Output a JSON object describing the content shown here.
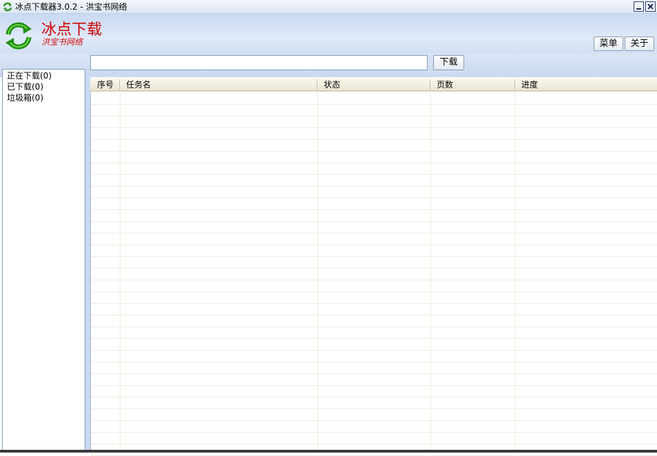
{
  "window": {
    "title": "冰点下载器3.0.2 - 洪宝书网络",
    "icon": "refresh-arrows-icon",
    "controls": [
      "minimize-icon",
      "close-icon"
    ]
  },
  "header": {
    "brand_title": "冰点下载",
    "brand_subtitle": "洪宝书网络",
    "menu_label": "菜单",
    "about_label": "关于"
  },
  "toolbar": {
    "url_value": "",
    "download_label": "下载"
  },
  "sidebar": {
    "items": [
      {
        "label": "正在下载(0)"
      },
      {
        "label": "已下载(0)"
      },
      {
        "label": "垃圾箱(0)"
      }
    ]
  },
  "table": {
    "columns": [
      "序号",
      "任务名",
      "状态",
      "页数",
      "进度"
    ],
    "rows": []
  },
  "colors": {
    "brand_red": "#cc0000",
    "header_blue": "#c8d9f1",
    "column_header_bg": "#f4f1e4"
  }
}
